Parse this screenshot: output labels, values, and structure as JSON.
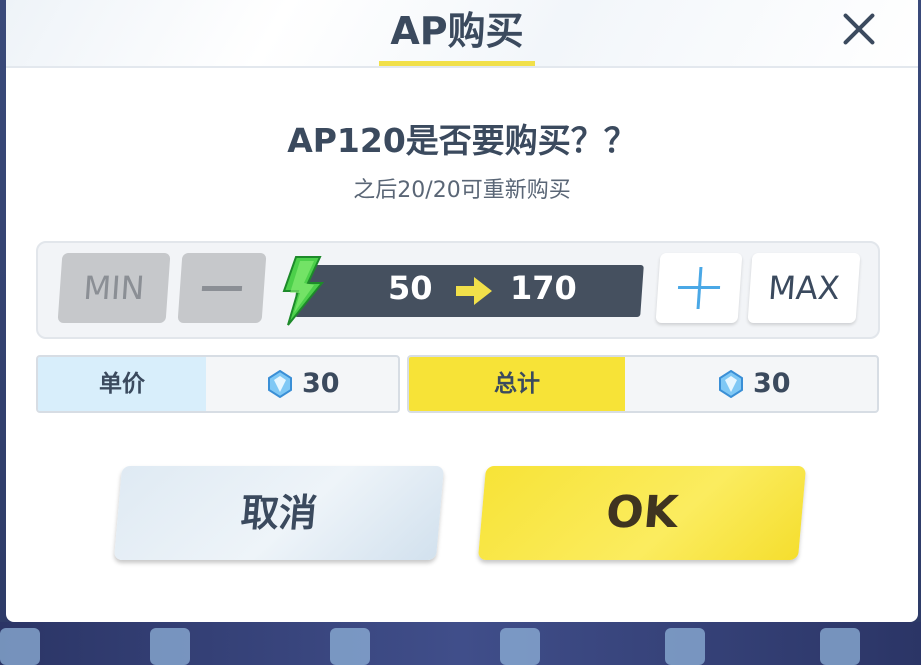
{
  "dialog": {
    "title": "AP购买",
    "question": "AP120是否要购买？？",
    "subtitle": "之后20/20可重新购买"
  },
  "quantity": {
    "min_label": "MIN",
    "max_label": "MAX",
    "ap_from": "50",
    "ap_to": "170"
  },
  "price": {
    "unit_label": "单价",
    "unit_value": "30",
    "total_label": "总计",
    "total_value": "30"
  },
  "buttons": {
    "cancel_label": "取消",
    "ok_label": "OK"
  },
  "colors": {
    "accent_yellow": "#F7E337",
    "unit_label_bg": "#D8EEFB",
    "text_dark": "#3B4A5E",
    "ap_bar": "#45505F",
    "bolt_green": "#4CD04A"
  },
  "icons": [
    "close-icon",
    "lightning-bolt-icon",
    "right-arrow-icon",
    "plus-icon",
    "minus-icon",
    "blue-gem-icon"
  ]
}
